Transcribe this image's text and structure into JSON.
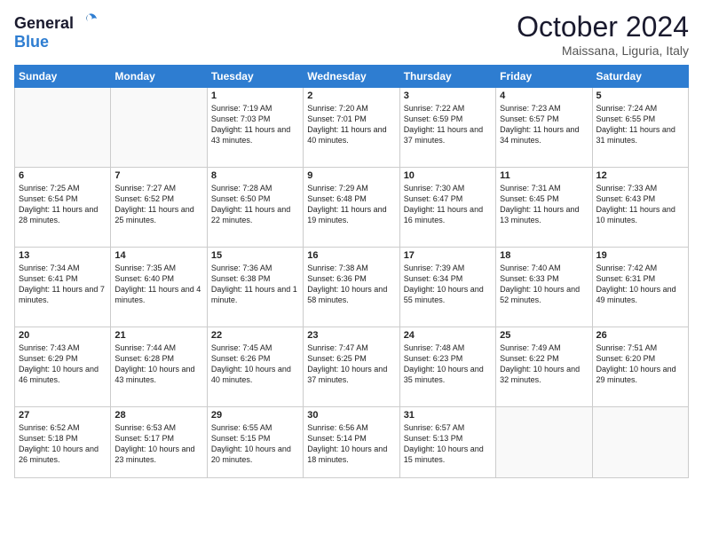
{
  "logo": {
    "line1": "General",
    "line2": "Blue"
  },
  "title": "October 2024",
  "location": "Maissana, Liguria, Italy",
  "headers": [
    "Sunday",
    "Monday",
    "Tuesday",
    "Wednesday",
    "Thursday",
    "Friday",
    "Saturday"
  ],
  "weeks": [
    [
      {
        "day": "",
        "info": ""
      },
      {
        "day": "",
        "info": ""
      },
      {
        "day": "1",
        "info": "Sunrise: 7:19 AM\nSunset: 7:03 PM\nDaylight: 11 hours and 43 minutes."
      },
      {
        "day": "2",
        "info": "Sunrise: 7:20 AM\nSunset: 7:01 PM\nDaylight: 11 hours and 40 minutes."
      },
      {
        "day": "3",
        "info": "Sunrise: 7:22 AM\nSunset: 6:59 PM\nDaylight: 11 hours and 37 minutes."
      },
      {
        "day": "4",
        "info": "Sunrise: 7:23 AM\nSunset: 6:57 PM\nDaylight: 11 hours and 34 minutes."
      },
      {
        "day": "5",
        "info": "Sunrise: 7:24 AM\nSunset: 6:55 PM\nDaylight: 11 hours and 31 minutes."
      }
    ],
    [
      {
        "day": "6",
        "info": "Sunrise: 7:25 AM\nSunset: 6:54 PM\nDaylight: 11 hours and 28 minutes."
      },
      {
        "day": "7",
        "info": "Sunrise: 7:27 AM\nSunset: 6:52 PM\nDaylight: 11 hours and 25 minutes."
      },
      {
        "day": "8",
        "info": "Sunrise: 7:28 AM\nSunset: 6:50 PM\nDaylight: 11 hours and 22 minutes."
      },
      {
        "day": "9",
        "info": "Sunrise: 7:29 AM\nSunset: 6:48 PM\nDaylight: 11 hours and 19 minutes."
      },
      {
        "day": "10",
        "info": "Sunrise: 7:30 AM\nSunset: 6:47 PM\nDaylight: 11 hours and 16 minutes."
      },
      {
        "day": "11",
        "info": "Sunrise: 7:31 AM\nSunset: 6:45 PM\nDaylight: 11 hours and 13 minutes."
      },
      {
        "day": "12",
        "info": "Sunrise: 7:33 AM\nSunset: 6:43 PM\nDaylight: 11 hours and 10 minutes."
      }
    ],
    [
      {
        "day": "13",
        "info": "Sunrise: 7:34 AM\nSunset: 6:41 PM\nDaylight: 11 hours and 7 minutes."
      },
      {
        "day": "14",
        "info": "Sunrise: 7:35 AM\nSunset: 6:40 PM\nDaylight: 11 hours and 4 minutes."
      },
      {
        "day": "15",
        "info": "Sunrise: 7:36 AM\nSunset: 6:38 PM\nDaylight: 11 hours and 1 minute."
      },
      {
        "day": "16",
        "info": "Sunrise: 7:38 AM\nSunset: 6:36 PM\nDaylight: 10 hours and 58 minutes."
      },
      {
        "day": "17",
        "info": "Sunrise: 7:39 AM\nSunset: 6:34 PM\nDaylight: 10 hours and 55 minutes."
      },
      {
        "day": "18",
        "info": "Sunrise: 7:40 AM\nSunset: 6:33 PM\nDaylight: 10 hours and 52 minutes."
      },
      {
        "day": "19",
        "info": "Sunrise: 7:42 AM\nSunset: 6:31 PM\nDaylight: 10 hours and 49 minutes."
      }
    ],
    [
      {
        "day": "20",
        "info": "Sunrise: 7:43 AM\nSunset: 6:29 PM\nDaylight: 10 hours and 46 minutes."
      },
      {
        "day": "21",
        "info": "Sunrise: 7:44 AM\nSunset: 6:28 PM\nDaylight: 10 hours and 43 minutes."
      },
      {
        "day": "22",
        "info": "Sunrise: 7:45 AM\nSunset: 6:26 PM\nDaylight: 10 hours and 40 minutes."
      },
      {
        "day": "23",
        "info": "Sunrise: 7:47 AM\nSunset: 6:25 PM\nDaylight: 10 hours and 37 minutes."
      },
      {
        "day": "24",
        "info": "Sunrise: 7:48 AM\nSunset: 6:23 PM\nDaylight: 10 hours and 35 minutes."
      },
      {
        "day": "25",
        "info": "Sunrise: 7:49 AM\nSunset: 6:22 PM\nDaylight: 10 hours and 32 minutes."
      },
      {
        "day": "26",
        "info": "Sunrise: 7:51 AM\nSunset: 6:20 PM\nDaylight: 10 hours and 29 minutes."
      }
    ],
    [
      {
        "day": "27",
        "info": "Sunrise: 6:52 AM\nSunset: 5:18 PM\nDaylight: 10 hours and 26 minutes."
      },
      {
        "day": "28",
        "info": "Sunrise: 6:53 AM\nSunset: 5:17 PM\nDaylight: 10 hours and 23 minutes."
      },
      {
        "day": "29",
        "info": "Sunrise: 6:55 AM\nSunset: 5:15 PM\nDaylight: 10 hours and 20 minutes."
      },
      {
        "day": "30",
        "info": "Sunrise: 6:56 AM\nSunset: 5:14 PM\nDaylight: 10 hours and 18 minutes."
      },
      {
        "day": "31",
        "info": "Sunrise: 6:57 AM\nSunset: 5:13 PM\nDaylight: 10 hours and 15 minutes."
      },
      {
        "day": "",
        "info": ""
      },
      {
        "day": "",
        "info": ""
      }
    ]
  ]
}
